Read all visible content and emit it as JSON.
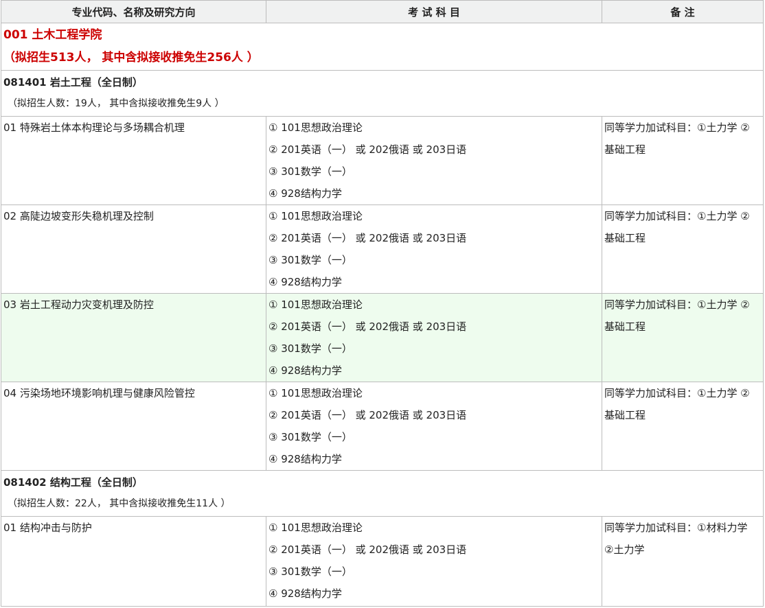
{
  "header": {
    "col1": "专业代码、名称及研究方向",
    "col2": "考 试 科 目",
    "col3": "备 注"
  },
  "school": {
    "name": "001 土木工程学院",
    "quota": "（拟招生513人， 其中含拟接收推免生256人 ）"
  },
  "majors": [
    {
      "title": "081401 岩土工程（全日制）",
      "quota": "（拟招生人数：19人， 其中含拟接收推免生9人 ）",
      "directions": [
        {
          "name": "01 特殊岩土体本构理论与多场耦合机理",
          "subjects": [
            "① 101思想政治理论",
            "② 201英语（一） 或 202俄语 或 203日语",
            "③ 301数学（一）",
            "④ 928结构力学"
          ],
          "note_lines": [
            "同等学力加试科目：①土力学 ②",
            "基础工程"
          ]
        },
        {
          "name": "02 高陡边坡变形失稳机理及控制",
          "subjects": [
            "① 101思想政治理论",
            "② 201英语（一） 或 202俄语 或 203日语",
            "③ 301数学（一）",
            "④ 928结构力学"
          ],
          "note_lines": [
            "同等学力加试科目：①土力学 ②",
            "基础工程"
          ]
        },
        {
          "name": "03 岩土工程动力灾变机理及防控",
          "subjects": [
            "① 101思想政治理论",
            "② 201英语（一） 或 202俄语 或 203日语",
            "③ 301数学（一）",
            "④ 928结构力学"
          ],
          "note_lines": [
            "同等学力加试科目：①土力学 ②",
            "基础工程"
          ]
        },
        {
          "name": "04 污染场地环境影响机理与健康风险管控",
          "subjects": [
            "① 101思想政治理论",
            "② 201英语（一） 或 202俄语 或 203日语",
            "③ 301数学（一）",
            "④ 928结构力学"
          ],
          "note_lines": [
            "同等学力加试科目：①土力学 ②",
            "基础工程"
          ]
        }
      ]
    },
    {
      "title": "081402 结构工程（全日制）",
      "quota": "（拟招生人数：22人， 其中含拟接收推免生11人 ）",
      "directions": [
        {
          "name": "01 结构冲击与防护",
          "subjects": [
            "① 101思想政治理论",
            "② 201英语（一） 或 202俄语 或 203日语",
            "③ 301数学（一）",
            "④ 928结构力学"
          ],
          "note_lines": [
            "同等学力加试科目：①材料力学",
            "②土力学"
          ]
        }
      ]
    }
  ],
  "colors": {
    "school_red": "#cc0000",
    "highlight_row": "#eefcee",
    "header_bg": "#f0f1f1"
  }
}
